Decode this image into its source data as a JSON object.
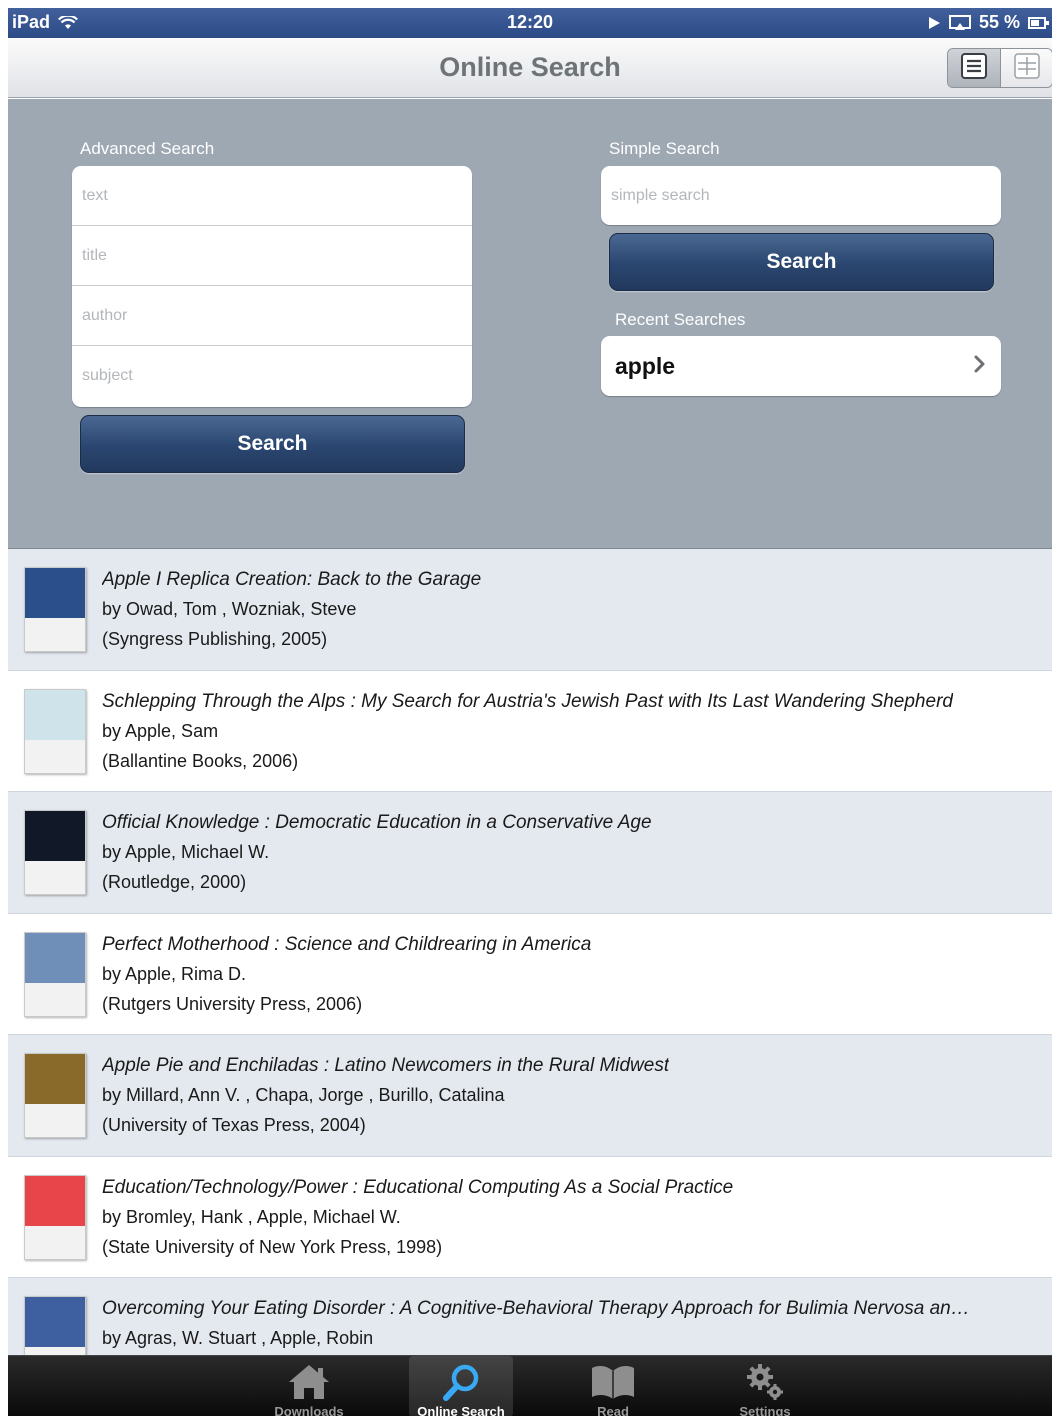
{
  "status_bar": {
    "device": "iPad",
    "time": "12:20",
    "battery": "55 %",
    "battery_level": 0.55
  },
  "nav": {
    "title": "Online Search",
    "view_toggle": [
      "list-view",
      "grid-view"
    ]
  },
  "advanced_search": {
    "label": "Advanced Search",
    "fields": [
      {
        "placeholder": "text",
        "value": ""
      },
      {
        "placeholder": "title",
        "value": ""
      },
      {
        "placeholder": "author",
        "value": ""
      },
      {
        "placeholder": "subject",
        "value": ""
      }
    ],
    "button": "Search"
  },
  "simple_search": {
    "label": "Simple Search",
    "placeholder": "simple search",
    "value": "",
    "button": "Search"
  },
  "recent_searches": {
    "label": "Recent Searches",
    "items": [
      "apple"
    ]
  },
  "results": [
    {
      "title": "Apple I Replica Creation: Back to the Garage",
      "author": "by Owad, Tom , Wozniak, Steve",
      "publisher": "(Syngress Publishing, 2005)",
      "cover": "#2b4f8a"
    },
    {
      "title": "Schlepping Through the Alps : My Search for Austria's Jewish Past with Its Last Wandering Shepherd",
      "author": "by Apple, Sam",
      "publisher": "(Ballantine Books, 2006)",
      "cover": "#cfe3ea"
    },
    {
      "title": "Official Knowledge : Democratic Education in a Conservative Age",
      "author": "by Apple, Michael W.",
      "publisher": "(Routledge, 2000)",
      "cover": "#111827"
    },
    {
      "title": "Perfect Motherhood : Science and Childrearing in America",
      "author": "by Apple, Rima D.",
      "publisher": "(Rutgers University Press, 2006)",
      "cover": "#6f8fb8"
    },
    {
      "title": "Apple Pie and Enchiladas : Latino Newcomers in the Rural Midwest",
      "author": "by Millard, Ann V. , Chapa, Jorge , Burillo, Catalina",
      "publisher": "(University of Texas Press, 2004)",
      "cover": "#8a6a2a"
    },
    {
      "title": "Education/Technology/Power : Educational Computing As a Social Practice",
      "author": "by Bromley, Hank , Apple, Michael W.",
      "publisher": "(State University of New York Press, 1998)",
      "cover": "#e8454b"
    },
    {
      "title": "Overcoming Your Eating Disorder : A Cognitive-Behavioral Therapy Approach for Bulimia Nervosa an…",
      "author": "by Agras, W. Stuart , Apple, Robin",
      "publisher": "",
      "cover": "#3e5fa0"
    }
  ],
  "tabs": [
    {
      "label": "Downloads",
      "icon": "house-icon",
      "active": false
    },
    {
      "label": "Online Search",
      "icon": "magnifier-icon",
      "active": true
    },
    {
      "label": "Read",
      "icon": "book-icon",
      "active": false
    },
    {
      "label": "Settings",
      "icon": "gear-icon",
      "active": false
    }
  ],
  "colors": {
    "panel": "#9ea8b3",
    "button": "#2a4670",
    "row_alt": "#e3e9ef"
  }
}
